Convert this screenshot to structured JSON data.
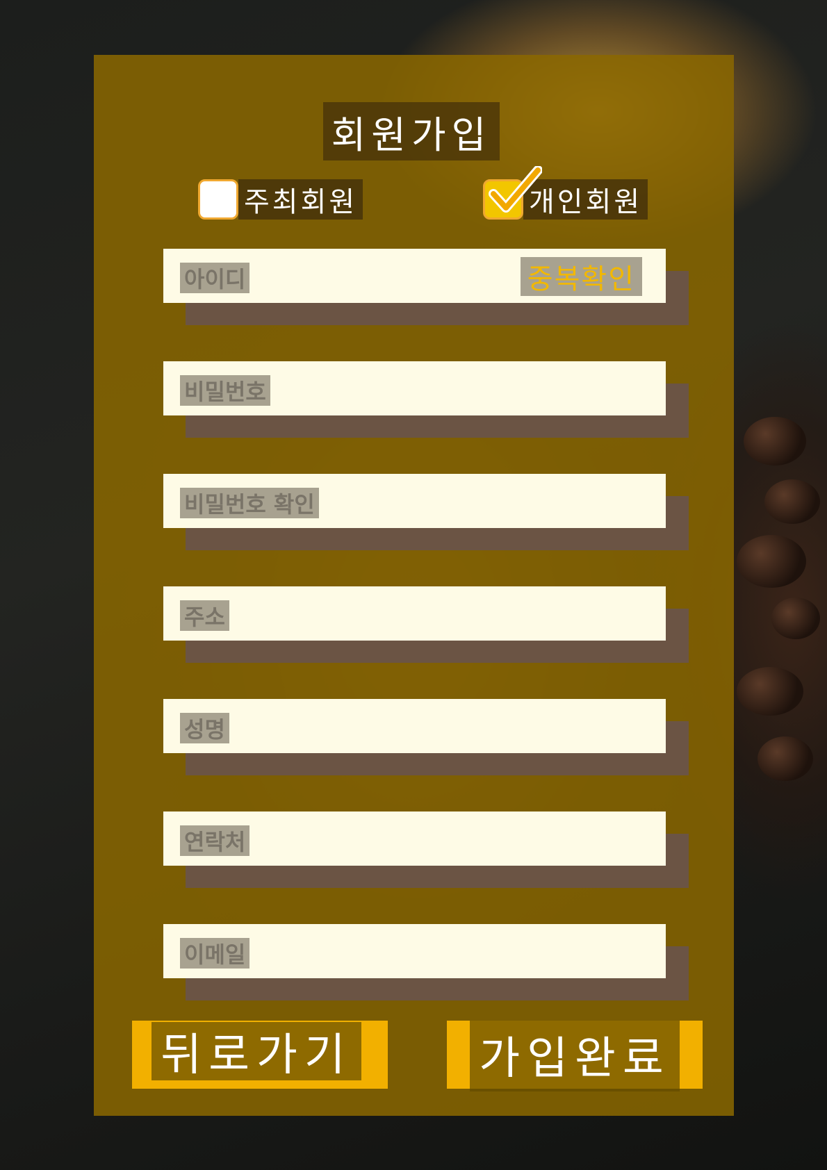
{
  "form": {
    "title": "회원가입",
    "member_types": [
      {
        "label": "주최회원",
        "checked": false
      },
      {
        "label": "개인회원",
        "checked": true
      }
    ],
    "fields": [
      {
        "placeholder": "아이디"
      },
      {
        "placeholder": "비밀번호"
      },
      {
        "placeholder": "비밀번호 확인"
      },
      {
        "placeholder": "주소"
      },
      {
        "placeholder": "성명"
      },
      {
        "placeholder": "연락처"
      },
      {
        "placeholder": "이메일"
      }
    ],
    "duplicate_check_label": "중복확인",
    "back_label": "뒤로가기",
    "submit_label": "가입완료"
  },
  "colors": {
    "panel": "#8a6800",
    "accent": "#f2b000",
    "input_bg": "#fefbe6",
    "input_shadow": "#6b5444"
  }
}
